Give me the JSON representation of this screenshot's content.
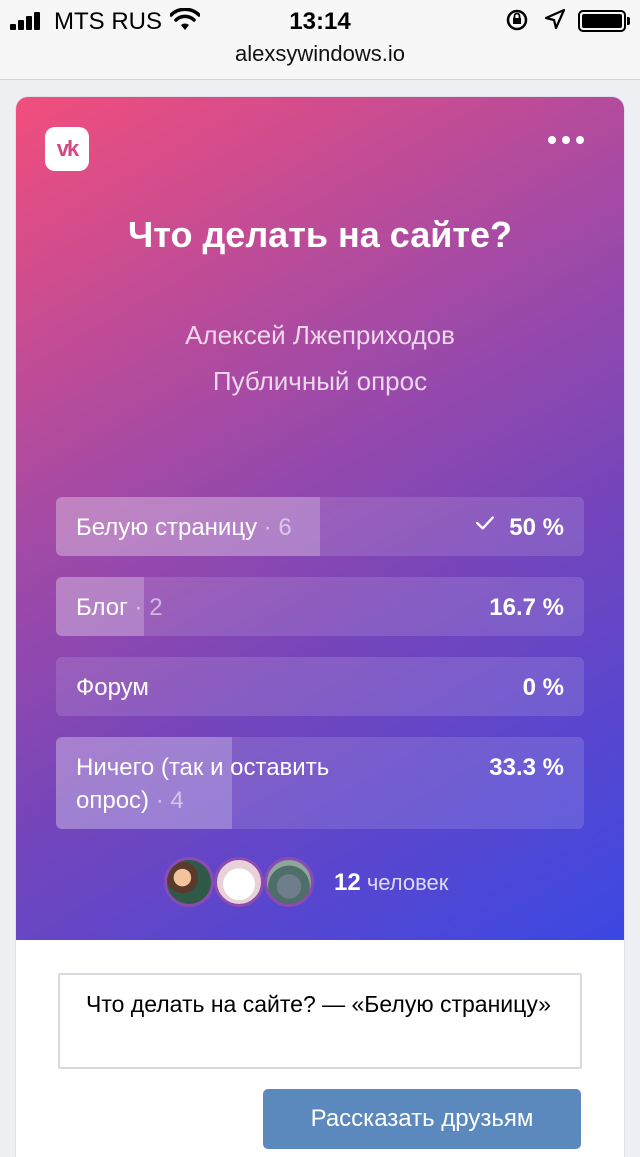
{
  "status_bar": {
    "carrier": "MTS RUS",
    "time": "13:14"
  },
  "browser": {
    "url": "alexsywindows.io"
  },
  "poll": {
    "title": "Что делать на сайте?",
    "author": "Алексей Лжеприходов",
    "type": "Публичный опрос",
    "options": [
      {
        "label": "Белую страницу",
        "count": "6",
        "percent": "50 %",
        "share": 0.5,
        "selected": true
      },
      {
        "label": "Блог",
        "count": "2",
        "percent": "16.7 %",
        "share": 0.167,
        "selected": false
      },
      {
        "label": "Форум",
        "count": "",
        "percent": "0 %",
        "share": 0,
        "selected": false
      },
      {
        "label": "Ничего (так и оставить опрос)",
        "count": "4",
        "percent": "33.3 %",
        "share": 0.333,
        "selected": false
      }
    ],
    "separator": "·",
    "voters_count": "12",
    "voters_label": "человек"
  },
  "share": {
    "text": "Что делать на сайте? — «Белую страницу»",
    "button_label": "Рассказать друзьям"
  },
  "colors": {
    "gradient_start": "#f24e7c",
    "gradient_end": "#3b48e3",
    "button": "#5b88bd"
  }
}
